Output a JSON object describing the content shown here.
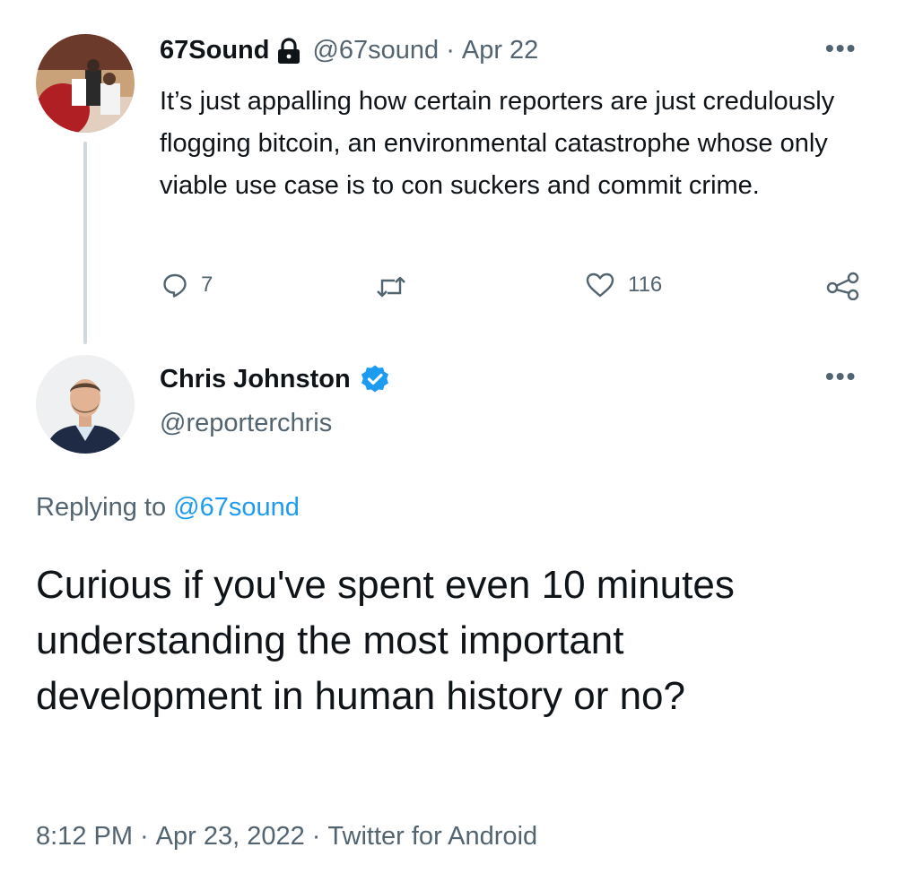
{
  "parent_tweet": {
    "display_name": "67Sound",
    "handle": "@67sound",
    "separator": "·",
    "date": "Apr 22",
    "text": "It’s just appalling how certain reporters are just credulously flogging bitcoin, an environmental catastrophe whose only viable use case is to con suckers and commit crime.",
    "protected_icon": "lock-icon",
    "more_label": "•••",
    "actions": {
      "reply_count": "7",
      "retweet_count": "",
      "like_count": "116"
    }
  },
  "reply_tweet": {
    "display_name": "Chris Johnston",
    "handle": "@reporterchris",
    "verified_icon": "verified-badge-icon",
    "more_label": "•••",
    "replying_prefix": "Replying to",
    "replying_to": "@67sound",
    "text": "Curious if you've spent even 10 minutes understanding the most important development in human history or no?",
    "time": "8:12 PM",
    "date": "Apr 23, 2022",
    "separator": "·",
    "source": "Twitter for Android"
  },
  "colors": {
    "text_primary": "#0f1419",
    "text_secondary": "#536471",
    "link": "#1d9bf0",
    "verified": "#1d9bf0",
    "thread_line": "#cfd9de"
  }
}
